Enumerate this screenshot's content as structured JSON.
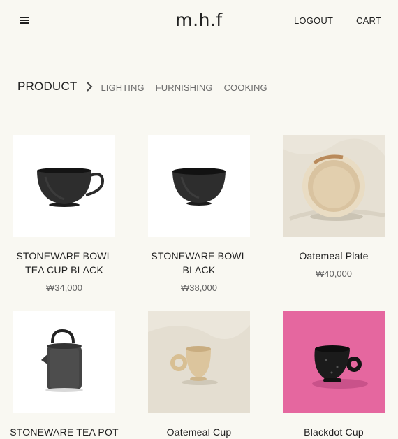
{
  "header": {
    "logo": "m.h.f",
    "logout_label": "LOGOUT",
    "cart_label": "CART",
    "menu_icon": "hamburger-menu-icon"
  },
  "breadcrumb": {
    "current": "PRODUCT",
    "separator_icon": "chevron-right-icon",
    "categories": [
      "LIGHTING",
      "FURNISHING",
      "COOKING"
    ]
  },
  "products": [
    {
      "name_line1": "STONEWARE BOWL",
      "name_line2": "TEA CUP BLACK",
      "price": "₩34,000",
      "image": "black-teacup"
    },
    {
      "name_line1": "STONEWARE BOWL",
      "name_line2": "BLACK",
      "price": "₩38,000",
      "image": "black-bowl"
    },
    {
      "name_line1": "Oatemeal Plate",
      "name_line2": "",
      "price": "₩40,000",
      "image": "oatmeal-plate"
    },
    {
      "name_line1": "STONEWARE TEA POT",
      "name_line2": "",
      "price": "",
      "image": "black-teapot"
    },
    {
      "name_line1": "Oatemeal Cup",
      "name_line2": "",
      "price": "",
      "image": "oatmeal-cup"
    },
    {
      "name_line1": "Blackdot Cup",
      "name_line2": "",
      "price": "",
      "image": "blackdot-cup"
    }
  ],
  "colors": {
    "background": "#f9f8f2",
    "text": "#1f1f1f",
    "muted": "#6d6d6d",
    "pink_backdrop": "#e5679f"
  }
}
